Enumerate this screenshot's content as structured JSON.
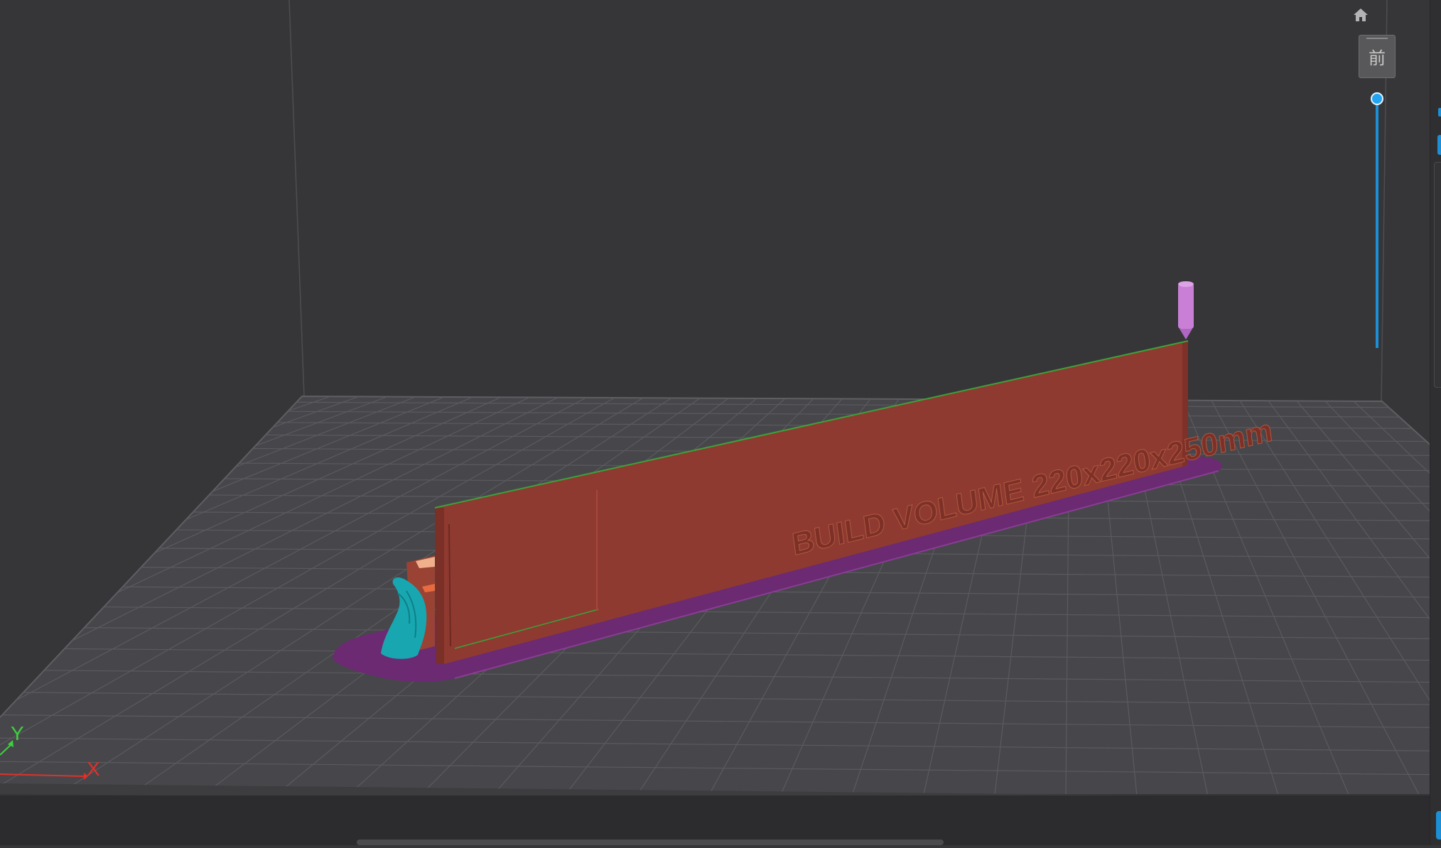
{
  "viewport": {
    "model_label": "BUILD VOLUME 220x220x250mm",
    "axis_x_label": "X",
    "axis_y_label": "Y",
    "view_cube_label": "前",
    "home_icon": "home-icon",
    "colors": {
      "background": "#363638",
      "bed": "#48484c",
      "grid": "#5a5a5e",
      "model_wall": "#8f3a30",
      "raft": "#6b2a72",
      "support": "#18a7b0",
      "nozzle": "#c97fd6",
      "top_edge": "#2e8b2e",
      "layer_slider": "#1d8fd6"
    }
  },
  "layer_slider": {
    "position": 1.0
  }
}
